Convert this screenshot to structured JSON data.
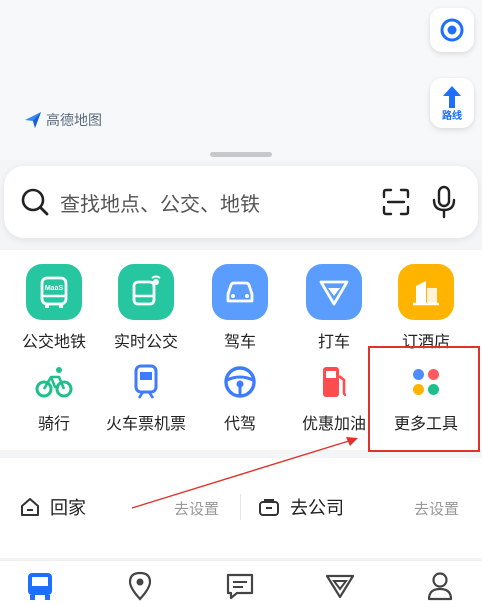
{
  "brand": {
    "name": "高德地图"
  },
  "map_controls": {
    "route_label": "路线"
  },
  "search": {
    "placeholder": "查找地点、公交、地铁"
  },
  "services": [
    {
      "label": "公交地铁",
      "icon": "bus-icon",
      "badge": "MaaS",
      "color": "#25c6a0"
    },
    {
      "label": "实时公交",
      "icon": "realtime-bus-icon",
      "color": "#25c6a0"
    },
    {
      "label": "驾车",
      "icon": "car-icon",
      "color": "#5b9dff"
    },
    {
      "label": "打车",
      "icon": "taxi-icon",
      "color": "#5b9dff"
    },
    {
      "label": "订酒店",
      "icon": "hotel-icon",
      "color": "#ffb400"
    },
    {
      "label": "骑行",
      "icon": "bike-icon",
      "color": "#1ec08a"
    },
    {
      "label": "火车票机票",
      "icon": "train-icon",
      "color": "#3e7bff"
    },
    {
      "label": "代驾",
      "icon": "steering-wheel-icon",
      "color": "#3e7bff"
    },
    {
      "label": "优惠加油",
      "icon": "fuel-icon",
      "color": "#ff4d4f"
    },
    {
      "label": "更多工具",
      "icon": "more-tools-icon"
    }
  ],
  "shortcuts": {
    "home": {
      "label": "回家",
      "action": "去设置"
    },
    "work": {
      "label": "去公司",
      "action": "去设置"
    }
  },
  "tabs": [
    "bus-tab-icon",
    "location-tab-icon",
    "message-tab-icon",
    "taxi-tab-icon",
    "profile-tab-icon"
  ],
  "colors": {
    "accent": "#1f6fff",
    "highlight": "#e0322b"
  }
}
